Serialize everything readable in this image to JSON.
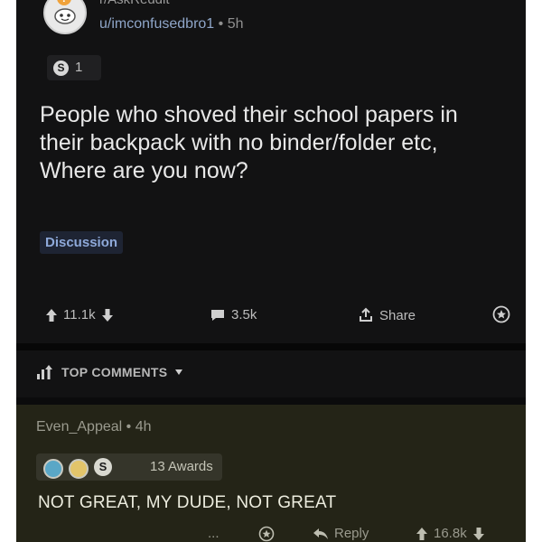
{
  "post": {
    "subreddit": "r/AskReddit",
    "author": "u/imconfusedbro1",
    "separator": "•",
    "age": "5h",
    "award_count": "1",
    "award_letter": "S",
    "title": "People who shoved their school papers in their backpack with no binder/folder etc, Where are you now?",
    "flair": "Discussion",
    "upvotes": "11.1k",
    "comments": "3.5k",
    "share_label": "Share"
  },
  "sort": {
    "label": "TOP COMMENTS"
  },
  "comment": {
    "author": "Even_Appeal",
    "separator": "•",
    "age": "4h",
    "award_letter": "S",
    "awards_label": "13 Awards",
    "body": "NOT GREAT, MY DUDE, NOT GREAT",
    "dots": "...",
    "reply_label": "Reply",
    "upvotes": "16.8k"
  },
  "colors": {
    "background": "#121213",
    "comment_background": "#242417",
    "username": "#8fa6c9",
    "flair_text": "#8ea9d9"
  },
  "icons": {
    "subreddit": "askreddit-avatar-icon",
    "upvote": "arrow-up-icon",
    "downvote": "arrow-down-icon",
    "comments": "comment-bubble-icon",
    "share": "share-icon",
    "award": "award-icon",
    "sort": "sort-bars-icon",
    "dropdown": "caret-down-icon",
    "reply": "reply-arrow-icon"
  }
}
